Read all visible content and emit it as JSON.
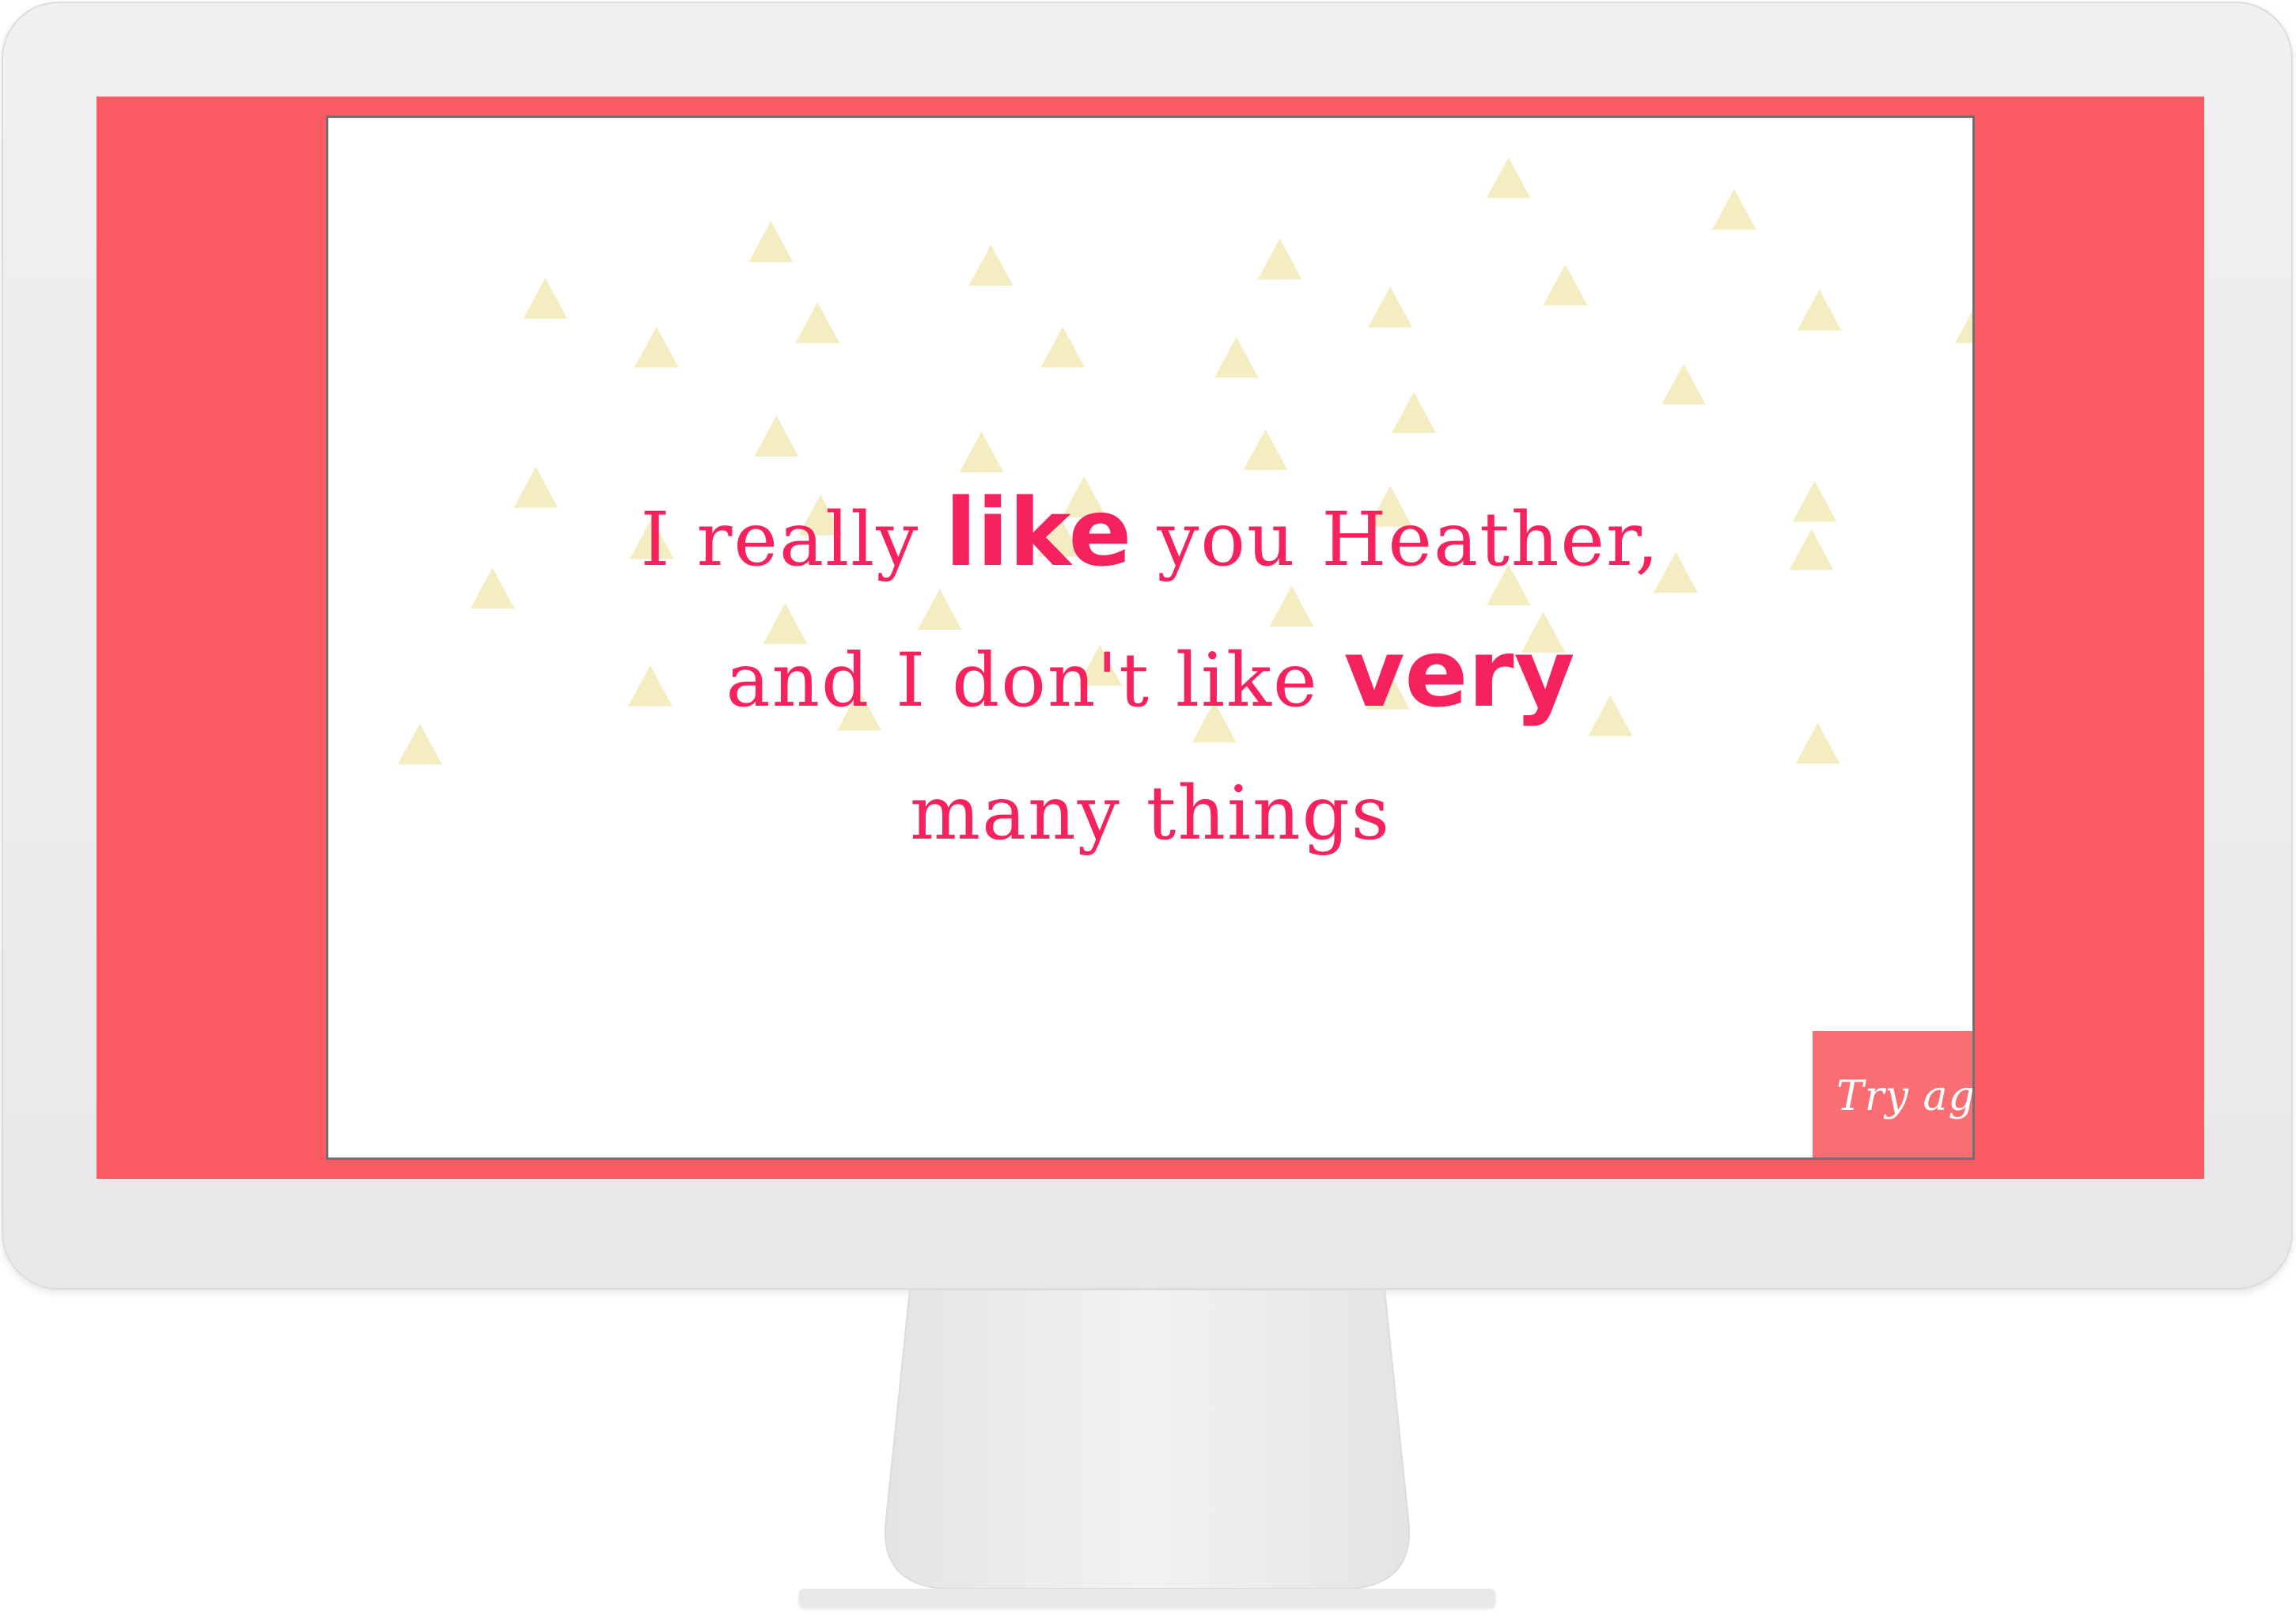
{
  "colors": {
    "bezel": "#eeeeee",
    "screen": "#fe5a64",
    "panel": "#ffffff",
    "text": "#f5225e",
    "triangle": "#f5edc2",
    "button": "#f96e72"
  },
  "message": {
    "line1": {
      "pre": "I really ",
      "em": "like",
      "post": " you Heather,"
    },
    "line2": {
      "pre": "and I don't like ",
      "em": "very",
      "post": ""
    },
    "line3": "many things"
  },
  "button": {
    "label": "Try again"
  }
}
